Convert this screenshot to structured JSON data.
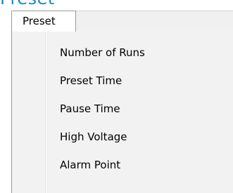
{
  "background_title": "Preset",
  "menu": {
    "header_label": "Preset",
    "items": [
      {
        "label": "Number of Runs"
      },
      {
        "label": "Preset Time"
      },
      {
        "label": "Pause Time"
      },
      {
        "label": "High Voltage"
      },
      {
        "label": "Alarm Point"
      }
    ]
  },
  "colors": {
    "title_blue": "#1c86c8",
    "menu_background": "#f2f2f2",
    "border": "#9a9a9a"
  }
}
